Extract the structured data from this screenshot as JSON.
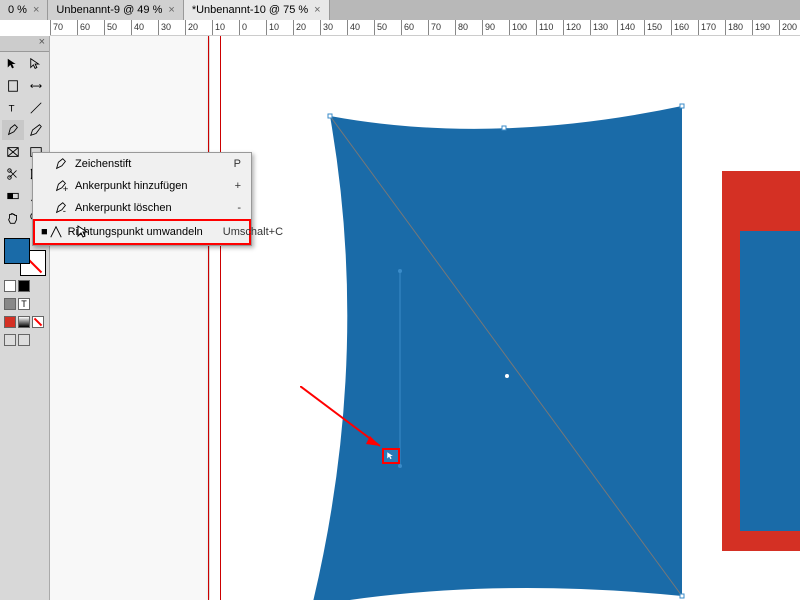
{
  "tabs": [
    {
      "label": "0 %",
      "close": "×"
    },
    {
      "label": "Unbenannt-9 @ 49 %",
      "close": "×"
    },
    {
      "label": "*Unbenannt-10 @ 75 %",
      "close": "×",
      "active": true
    }
  ],
  "ruler": {
    "ticks": [
      "70",
      "60",
      "50",
      "40",
      "30",
      "20",
      "10",
      "0",
      "10",
      "20",
      "30",
      "40",
      "50",
      "60",
      "70",
      "80",
      "90",
      "100",
      "110",
      "120",
      "130",
      "140",
      "150",
      "160",
      "170",
      "180",
      "190",
      "200"
    ]
  },
  "side_close": "×",
  "context_menu": {
    "items": [
      {
        "label": "Zeichenstift",
        "shortcut": "P"
      },
      {
        "label": "Ankerpunkt hinzufügen",
        "shortcut": "+"
      },
      {
        "label": "Ankerpunkt löschen",
        "shortcut": "-"
      },
      {
        "label": "Richtungspunkt umwandeln",
        "shortcut": "Umschalt+C",
        "selected": true
      }
    ]
  },
  "colors": {
    "fill": "#1a6ba8",
    "shape_blue": "#1a6ba8",
    "shape_red": "#d43024",
    "highlight_red": "#ff0000"
  }
}
